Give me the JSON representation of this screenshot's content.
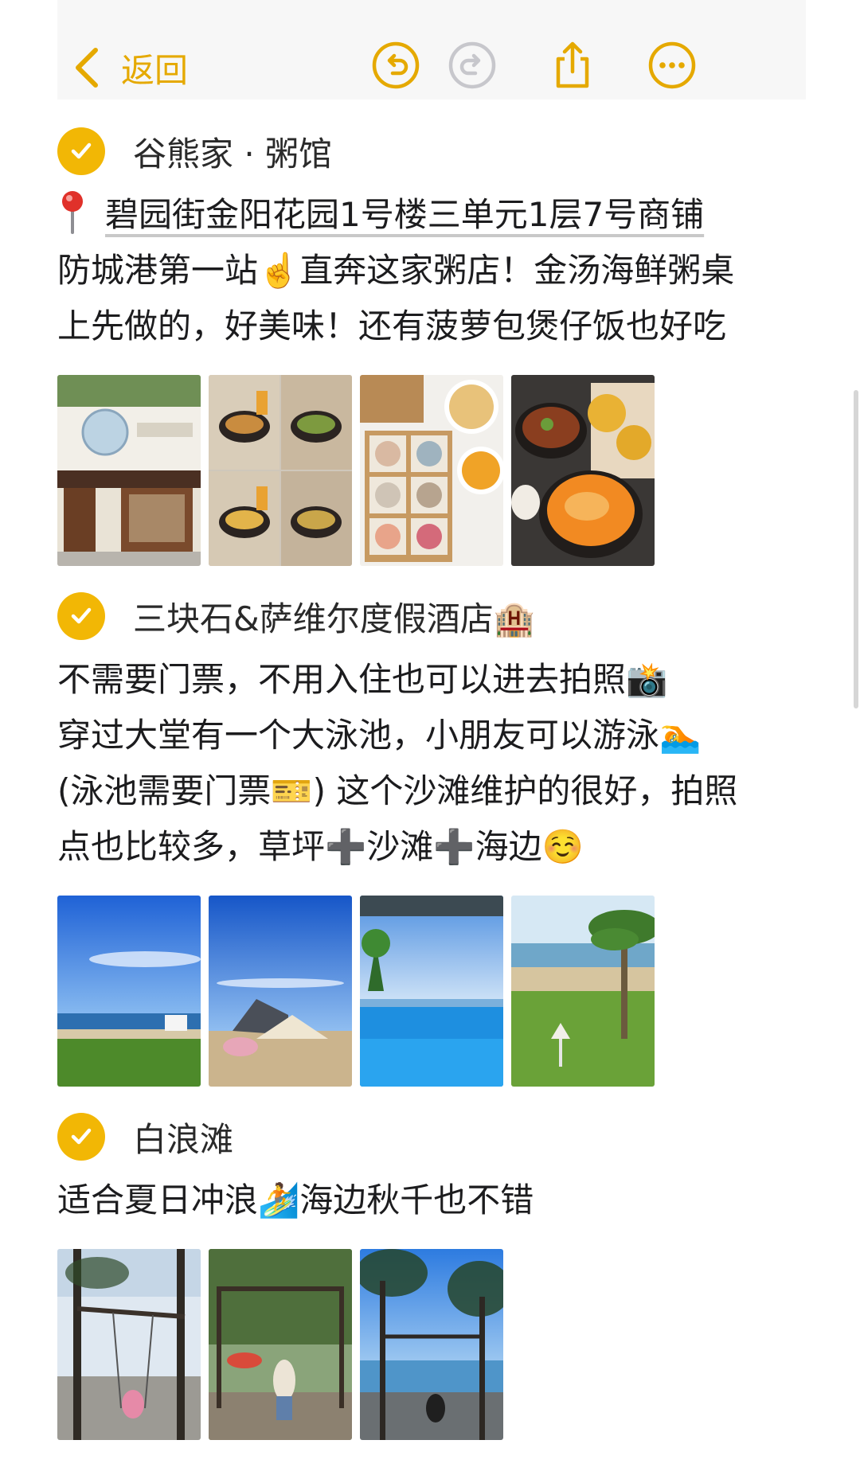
{
  "nav": {
    "back_label": "返回",
    "icons": [
      "chevron-left-icon",
      "undo-icon",
      "redo-icon",
      "share-icon",
      "more-icon"
    ],
    "accent_color": "#e5a900",
    "disabled_color": "#c7c7cc"
  },
  "sections": [
    {
      "title": "谷熊家 · 粥馆",
      "address": "碧园街金阳花园1号楼三单元1层7号商铺",
      "lines": [
        "防城港第一站☝️直奔这家粥店！金汤海鲜粥桌",
        "上先做的，好美味！还有菠萝包煲仔饭也好吃"
      ],
      "photos": [
        "storefront-photo",
        "clay-pot-cooking-photo",
        "seafood-platter-photo",
        "clay-pot-rice-and-pineapple-bun-photo"
      ]
    },
    {
      "title": "三块石&萨维尔度假酒店🏨",
      "lines": [
        "不需要门票，不用入住也可以进去拍照📸",
        "穿过大堂有一个大泳池，小朋友可以游泳🏊",
        "(泳池需要门票🎫) 这个沙滩维护的很好，拍照",
        "点也比较多，草坪➕沙滩➕海边☺️"
      ],
      "photos": [
        "lawn-and-sea-photo",
        "beach-tent-photo",
        "infinity-pool-photo",
        "palm-tree-lawn-photo"
      ]
    },
    {
      "title": "白浪滩",
      "lines": [
        "适合夏日冲浪🏄海边秋千也不错"
      ],
      "photos": [
        "beach-swing-photo-1",
        "beach-swing-photo-2",
        "beach-swing-photo-3"
      ]
    }
  ],
  "colors": {
    "check_circle": "#f2b705",
    "text": "#1c1c1e",
    "nav_background": "#f7f7f7"
  }
}
